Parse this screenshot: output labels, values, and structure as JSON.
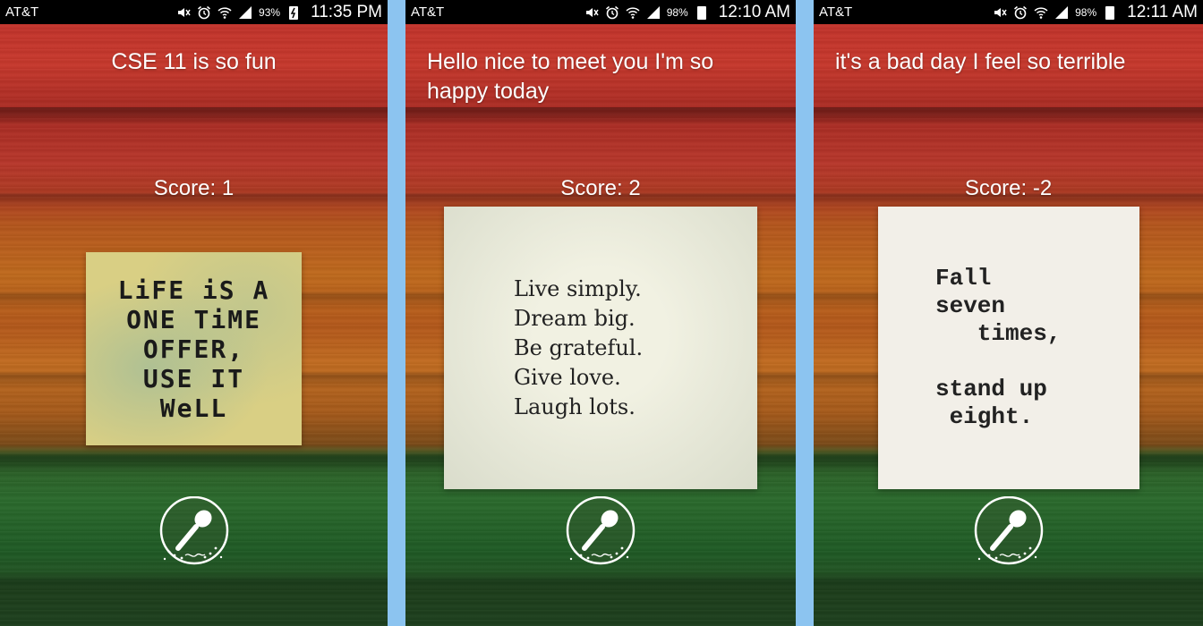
{
  "screens": [
    {
      "status": {
        "carrier": "AT&T",
        "battery": "93%",
        "time": "11:35 PM"
      },
      "spoken_text": "CSE 11 is so fun",
      "score": "Score: 1",
      "quote_lines": [
        "LiFE iS A",
        "ONE TiME",
        "OFFER,",
        "USE IT",
        "WeLL"
      ]
    },
    {
      "status": {
        "carrier": "AT&T",
        "battery": "98%",
        "time": "12:10 AM"
      },
      "spoken_text": "Hello nice to meet you I'm so happy today",
      "score": "Score: 2",
      "quote_lines": [
        "Live simply.",
        "Dream big.",
        "Be grateful.",
        "Give love.",
        "Laugh lots."
      ]
    },
    {
      "status": {
        "carrier": "AT&T",
        "battery": "98%",
        "time": "12:11 AM"
      },
      "spoken_text": "it's a bad day I feel so terrible",
      "score": "Score: -2",
      "quote_lines": [
        "Fall",
        "seven",
        "   times,",
        "",
        "stand up",
        " eight."
      ]
    }
  ],
  "icons": {
    "status": [
      "mute-icon",
      "alarm-icon",
      "wifi-icon",
      "signal-icon",
      "battery-icon"
    ],
    "action": "microphone-icon"
  },
  "colors": {
    "divider": "#8cc4f0",
    "statusbar": "#000000",
    "text": "#ffffff"
  }
}
